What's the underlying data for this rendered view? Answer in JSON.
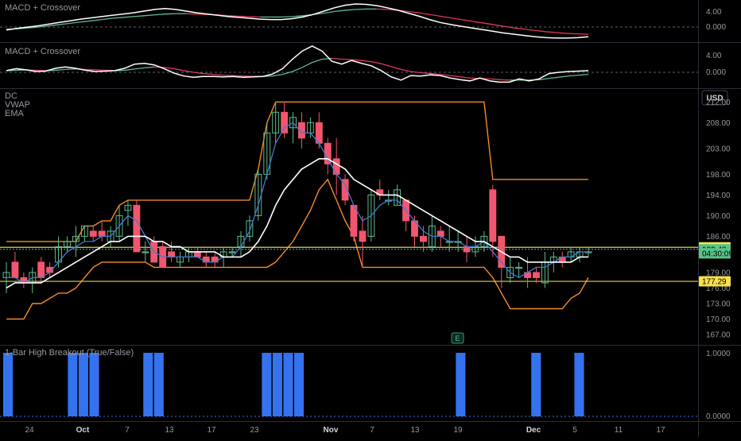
{
  "panes": {
    "macd1": {
      "title": "MACD + Crossover",
      "ticks": [
        "4.00",
        "0.000"
      ]
    },
    "macd2": {
      "title": "MACD + Crossover",
      "ticks": [
        "4.00",
        "0.000"
      ]
    },
    "main": {
      "indicators": [
        "DC",
        "VWAP",
        "EMA"
      ],
      "currency": "USD",
      "price_ticks": [
        "212.00",
        "208.00",
        "203.00",
        "198.00",
        "194.00",
        "190.00",
        "186.00",
        "179.00",
        "176.00",
        "173.00",
        "170.00",
        "167.00"
      ],
      "badges": [
        {
          "label": "183.87",
          "value": 183.87,
          "bg": "#f7e04b",
          "fg": "#000000"
        },
        {
          "label": "183.48",
          "value": 183.48,
          "bg": "#58c488",
          "fg": "#000000"
        },
        {
          "label": "04:30:09",
          "value": 182.7,
          "bg": "#58c488",
          "fg": "#000000"
        },
        {
          "label": "177.29",
          "value": 177.29,
          "bg": "#f7e04b",
          "fg": "#000000"
        }
      ],
      "earnings_marker": "E"
    },
    "breakout": {
      "title": "1-Bar High Breakout (True/False)",
      "ticks": [
        "1.0000",
        "0.0000"
      ]
    }
  },
  "x_axis_labels": [
    "24",
    "Oct",
    "7",
    "13",
    "17",
    "23",
    "Nov",
    "7",
    "13",
    "19",
    "Dec",
    "5",
    "11",
    "17"
  ],
  "colors": {
    "bull": "#5ebc8e",
    "bear": "#f2566e",
    "donchian": "#f58a25",
    "level_line": "#e9d23b",
    "ema": "#ffffff",
    "vwap": "#3e7bd6",
    "macd_line": "#ffffff",
    "signal_line": "#5ebc8e",
    "signal_line_bear": "#e0385a",
    "breakout_bar": "#3572ef"
  },
  "chart_data": [
    {
      "type": "candlestick",
      "title": "DC / VWAP / EMA",
      "ylim": [
        165,
        215
      ],
      "levels": [
        183.87,
        177.29
      ],
      "last_price": 183.48,
      "ohlc": [
        [
          178,
          181,
          175,
          179
        ],
        [
          181,
          183,
          178,
          178
        ],
        [
          178,
          179,
          176,
          177
        ],
        [
          177,
          180,
          175,
          179
        ],
        [
          181,
          182,
          177,
          178
        ],
        [
          180,
          181,
          178,
          179
        ],
        [
          181,
          186,
          180,
          184
        ],
        [
          184,
          186,
          183,
          185
        ],
        [
          185,
          188,
          182,
          186
        ],
        [
          186,
          188,
          185,
          188
        ],
        [
          187,
          188,
          185,
          186
        ],
        [
          187,
          189,
          185,
          186
        ],
        [
          185,
          188,
          184,
          187
        ],
        [
          186,
          192,
          185,
          190
        ],
        [
          191,
          193,
          188,
          192
        ],
        [
          192,
          193,
          183,
          183
        ],
        [
          183,
          185,
          181,
          183
        ],
        [
          185,
          186,
          181,
          181
        ],
        [
          184,
          185,
          180,
          180
        ],
        [
          183,
          185,
          181,
          182
        ],
        [
          181,
          183,
          180,
          182
        ],
        [
          182,
          184,
          181,
          183
        ],
        [
          183,
          184,
          182,
          182
        ],
        [
          182,
          183,
          180,
          181
        ],
        [
          182,
          183,
          180,
          181
        ],
        [
          182,
          184,
          180,
          183
        ],
        [
          183,
          184,
          182,
          183
        ],
        [
          184,
          187,
          182,
          186
        ],
        [
          186,
          190,
          185,
          189
        ],
        [
          190,
          199,
          189,
          198
        ],
        [
          198,
          208,
          197,
          206
        ],
        [
          206,
          212,
          204,
          210
        ],
        [
          210,
          212,
          205,
          206
        ],
        [
          207,
          210,
          204,
          209
        ],
        [
          208,
          210,
          203,
          205
        ],
        [
          206,
          209,
          205,
          208
        ],
        [
          208,
          210,
          203,
          204
        ],
        [
          204,
          205,
          198,
          200
        ],
        [
          201,
          205,
          194,
          198
        ],
        [
          197,
          198,
          192,
          193
        ],
        [
          192,
          192,
          185,
          186
        ],
        [
          187,
          190,
          180,
          185
        ],
        [
          186,
          195,
          185,
          194
        ],
        [
          195,
          197,
          193,
          194
        ],
        [
          193,
          195,
          192,
          193
        ],
        [
          192,
          196,
          192,
          195
        ],
        [
          193,
          193,
          187,
          189
        ],
        [
          189,
          190,
          184,
          186
        ],
        [
          186,
          188,
          183,
          185
        ],
        [
          184,
          190,
          183,
          188
        ],
        [
          187,
          188,
          184,
          186
        ],
        [
          185,
          188,
          183,
          185
        ],
        [
          185,
          187,
          183,
          185
        ],
        [
          184,
          186,
          181,
          183
        ],
        [
          183,
          186,
          182,
          184
        ],
        [
          184,
          187,
          183,
          186
        ],
        [
          195,
          196,
          182,
          185
        ],
        [
          186,
          186,
          176,
          180
        ],
        [
          178,
          182,
          177,
          180
        ],
        [
          180,
          181,
          178,
          180
        ],
        [
          179,
          182,
          176,
          178
        ],
        [
          179,
          180,
          177,
          178
        ],
        [
          177,
          183,
          176,
          181
        ],
        [
          181,
          183,
          179,
          182
        ],
        [
          182,
          183,
          180,
          181
        ],
        [
          182,
          184,
          181,
          183
        ],
        [
          182,
          184,
          181,
          183
        ],
        [
          183,
          184,
          182,
          183
        ]
      ],
      "donchian_upper": [
        185,
        185,
        185,
        185,
        185,
        185,
        185,
        185,
        185,
        188,
        188,
        189,
        189,
        192,
        193,
        193,
        193,
        193,
        193,
        193,
        193,
        193,
        193,
        193,
        193,
        193,
        193,
        193,
        193,
        199,
        208,
        212,
        212,
        212,
        212,
        212,
        212,
        212,
        212,
        212,
        212,
        212,
        212,
        212,
        212,
        212,
        212,
        212,
        212,
        212,
        212,
        212,
        212,
        212,
        212,
        212,
        197,
        197,
        197,
        197,
        197,
        197,
        197,
        197,
        197,
        197,
        197,
        197
      ],
      "donchian_lower": [
        170,
        170,
        170,
        173,
        173,
        174,
        175,
        175,
        176,
        178,
        180,
        181,
        181,
        181,
        181,
        181,
        181,
        180,
        180,
        180,
        180,
        180,
        180,
        180,
        180,
        180,
        180,
        180,
        180,
        180,
        180,
        181,
        183,
        185,
        188,
        191,
        195,
        197,
        193,
        189,
        186,
        180,
        180,
        180,
        180,
        180,
        180,
        180,
        180,
        180,
        180,
        180,
        180,
        180,
        180,
        180,
        178,
        175,
        172,
        172,
        172,
        172,
        172,
        172,
        172,
        174,
        175,
        178
      ],
      "ema": [
        176,
        177,
        177,
        177,
        177,
        178,
        179,
        180,
        181,
        182,
        183,
        184,
        185,
        185,
        186,
        186,
        186,
        185,
        185,
        184,
        184,
        183,
        183,
        183,
        183,
        182,
        182,
        182,
        183,
        185,
        188,
        192,
        195,
        197,
        199,
        200,
        201,
        201,
        200,
        199,
        197,
        196,
        195,
        194,
        194,
        194,
        193,
        192,
        191,
        190,
        189,
        188,
        187,
        186,
        185,
        185,
        184,
        183,
        182,
        182,
        181,
        181,
        181,
        181,
        181,
        181,
        182,
        182
      ],
      "vwap": [
        178,
        178,
        177,
        178,
        178,
        179,
        181,
        183,
        184,
        185,
        185,
        186,
        186,
        188,
        190,
        189,
        186,
        183,
        182,
        182,
        182,
        182,
        182,
        181,
        181,
        182,
        182,
        184,
        187,
        192,
        198,
        204,
        207,
        208,
        206,
        206,
        204,
        201,
        198,
        196,
        192,
        189,
        190,
        192,
        193,
        193,
        191,
        189,
        187,
        186,
        186,
        185,
        185,
        184,
        184,
        185,
        183,
        181,
        179,
        178,
        179,
        180,
        180,
        181,
        182,
        182,
        183,
        183
      ]
    },
    {
      "type": "line",
      "title": "MACD + Crossover",
      "ylim": [
        -1.5,
        7
      ],
      "series": [
        {
          "values": [
            0.8,
            1.2,
            1.5,
            1.8,
            2.2,
            2.6,
            3.0,
            3.4,
            3.7,
            4.0,
            4.3,
            4.6,
            4.9,
            5.3,
            5.7,
            5.9,
            5.7,
            5.3,
            4.9,
            4.6,
            4.3,
            4.0,
            3.8,
            3.6,
            3.4,
            3.3,
            3.3,
            3.5,
            3.9,
            4.5,
            5.3,
            6.1,
            6.7,
            7.0,
            6.9,
            6.6,
            6.1,
            5.5,
            4.8,
            4.1,
            3.3,
            2.6,
            2.1,
            1.7,
            1.3,
            0.9,
            0.5,
            0.1,
            -0.2,
            -0.5,
            -0.8,
            -1.0,
            -1.1,
            -1.1,
            -1.0,
            -0.8
          ]
        },
        {
          "values": [
            1.0,
            1.1,
            1.3,
            1.5,
            1.8,
            2.1,
            2.4,
            2.7,
            3.0,
            3.3,
            3.6,
            3.8,
            4.0,
            4.2,
            4.4,
            4.6,
            4.7,
            4.7,
            4.6,
            4.5,
            4.4,
            4.2,
            4.1,
            4.0,
            3.9,
            3.9,
            3.9,
            4.0,
            4.2,
            4.5,
            4.8,
            5.2,
            5.5,
            5.7,
            5.8,
            5.8,
            5.7,
            5.5,
            5.2,
            4.9,
            4.5,
            4.1,
            3.7,
            3.3,
            2.9,
            2.5,
            2.1,
            1.7,
            1.3,
            1.0,
            0.7,
            0.4,
            0.2,
            0.0,
            -0.1,
            -0.2
          ]
        }
      ]
    },
    {
      "type": "line",
      "title": "MACD + Crossover",
      "ylim": [
        -2.5,
        7
      ],
      "series": [
        {
          "values": [
            1.0,
            1.5,
            1.2,
            0.8,
            0.9,
            1.6,
            1.9,
            1.6,
            1.1,
            0.8,
            0.9,
            1.0,
            1.6,
            2.6,
            2.8,
            2.4,
            1.5,
            0.4,
            -0.3,
            -0.6,
            -0.4,
            -0.4,
            -0.5,
            -0.4,
            -0.6,
            -0.5,
            -0.4,
            0.2,
            1.5,
            3.8,
            5.8,
            7.0,
            5.8,
            3.3,
            2.6,
            3.5,
            2.8,
            2.2,
            1.0,
            -0.5,
            -1.3,
            -0.2,
            -0.3,
            0.0,
            -0.2,
            -0.8,
            -1.2,
            -1.5,
            -0.8,
            -1.5,
            -1.8,
            -1.8,
            -1.0,
            -1.5,
            -1.0,
            0.3,
            0.6,
            0.8,
            0.9,
            1.0
          ]
        },
        {
          "values": [
            1.0,
            1.1,
            1.2,
            1.1,
            1.0,
            1.1,
            1.3,
            1.4,
            1.3,
            1.2,
            1.1,
            1.0,
            1.1,
            1.4,
            1.7,
            1.9,
            1.8,
            1.5,
            1.0,
            0.6,
            0.3,
            0.1,
            -0.1,
            -0.2,
            -0.3,
            -0.4,
            -0.4,
            -0.3,
            0.1,
            0.8,
            1.8,
            3.0,
            3.8,
            4.0,
            3.8,
            3.7,
            3.5,
            3.2,
            2.7,
            2.0,
            1.3,
            0.8,
            0.5,
            0.3,
            0.1,
            -0.2,
            -0.5,
            -0.8,
            -0.9,
            -1.0,
            -1.2,
            -1.3,
            -1.3,
            -1.3,
            -1.2,
            -0.9,
            -0.6,
            -0.3,
            -0.1,
            0.1
          ]
        }
      ]
    },
    {
      "type": "bar",
      "title": "1-Bar High Breakout (True/False)",
      "ylim": [
        0,
        1
      ],
      "values": [
        1,
        0,
        0,
        0,
        0,
        0,
        1,
        1,
        1,
        0,
        0,
        0,
        0,
        1,
        1,
        0,
        0,
        0,
        0,
        0,
        0,
        0,
        0,
        0,
        1,
        1,
        1,
        1,
        0,
        0,
        0,
        0,
        0,
        0,
        0,
        0,
        0,
        0,
        0,
        0,
        0,
        0,
        1,
        0,
        0,
        0,
        0,
        0,
        0,
        1,
        0,
        0,
        0,
        1
      ]
    }
  ]
}
